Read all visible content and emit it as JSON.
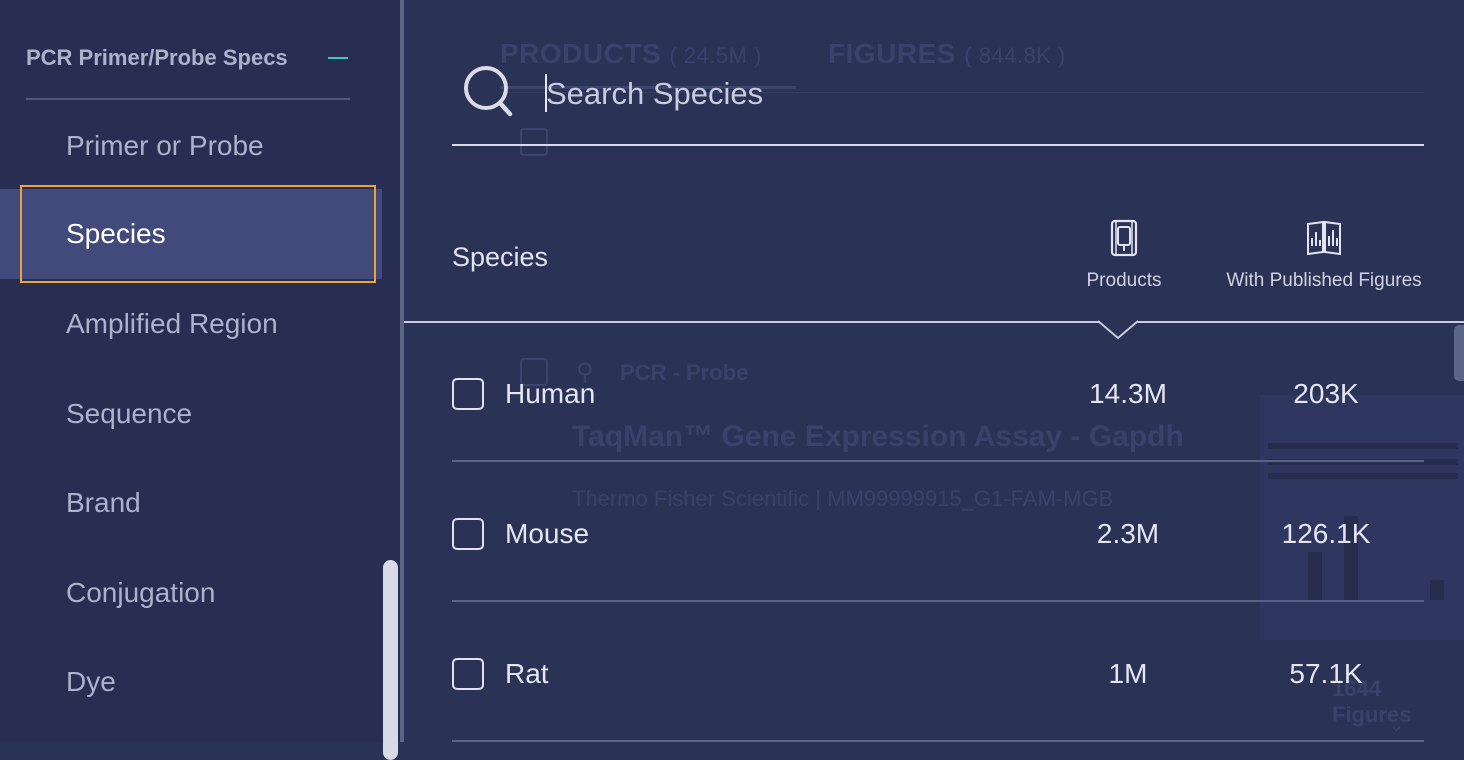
{
  "sidebar": {
    "section_title": "PCR Primer/Probe Specs",
    "items": [
      {
        "label": "Primer or Probe",
        "active": false
      },
      {
        "label": "Species",
        "active": true
      },
      {
        "label": "Amplified Region",
        "active": false
      },
      {
        "label": "Sequence",
        "active": false
      },
      {
        "label": "Brand",
        "active": false
      },
      {
        "label": "Conjugation",
        "active": false
      },
      {
        "label": "Dye",
        "active": false
      }
    ]
  },
  "background": {
    "tabs": [
      {
        "label": "PRODUCTS",
        "count": "( 24.5M )"
      },
      {
        "label": "FIGURES",
        "count": "( 844.8K )"
      }
    ],
    "result": {
      "category": "PCR - Probe",
      "title": "TaqMan™ Gene Expression Assay - Gapdh",
      "subtitle": "Thermo Fisher Scientific | MM99999915_G1-FAM-MGB",
      "figure_count": "1644 Figures"
    }
  },
  "filter_panel": {
    "search": {
      "placeholder": "Search Species",
      "value": ""
    },
    "columns": {
      "species": "Species",
      "products": "Products",
      "figures": "With Published Figures"
    },
    "rows": [
      {
        "name": "Human",
        "products": "14.3M",
        "figures": "203K",
        "checked": false
      },
      {
        "name": "Mouse",
        "products": "2.3M",
        "figures": "126.1K",
        "checked": false
      },
      {
        "name": "Rat",
        "products": "1M",
        "figures": "57.1K",
        "checked": false
      }
    ]
  },
  "colors": {
    "accent_teal": "#3fc4c8",
    "focus_orange": "#f0a23a",
    "sidebar_bg": "#272e52",
    "panel_bg": "#2a3255",
    "active_item_bg": "#414a7a"
  }
}
